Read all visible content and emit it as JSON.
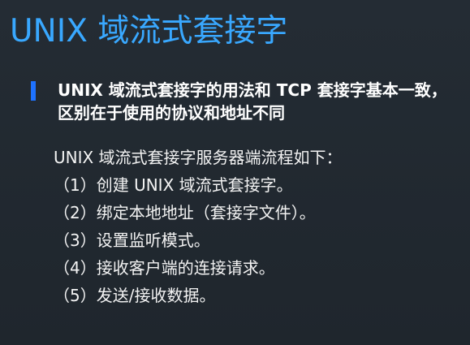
{
  "slide": {
    "title": "UNIX 域流式套接字",
    "bullet": "UNIX 域流式套接字的用法和 TCP 套接字基本一致，区别在于使用的协议和地址不同",
    "lines": [
      "UNIX 域流式套接字服务器端流程如下：",
      "（1）创建 UNIX 域流式套接字。",
      "（2）绑定本地地址（套接字文件）。",
      "（3）设置监听模式。",
      "（4）接收客户端的连接请求。",
      "（5）发送/接收数据。"
    ]
  },
  "colors": {
    "background": "#242c34",
    "title": "#39a8ff",
    "bullet_bar": "#1e72ff",
    "text": "#ffffff"
  }
}
